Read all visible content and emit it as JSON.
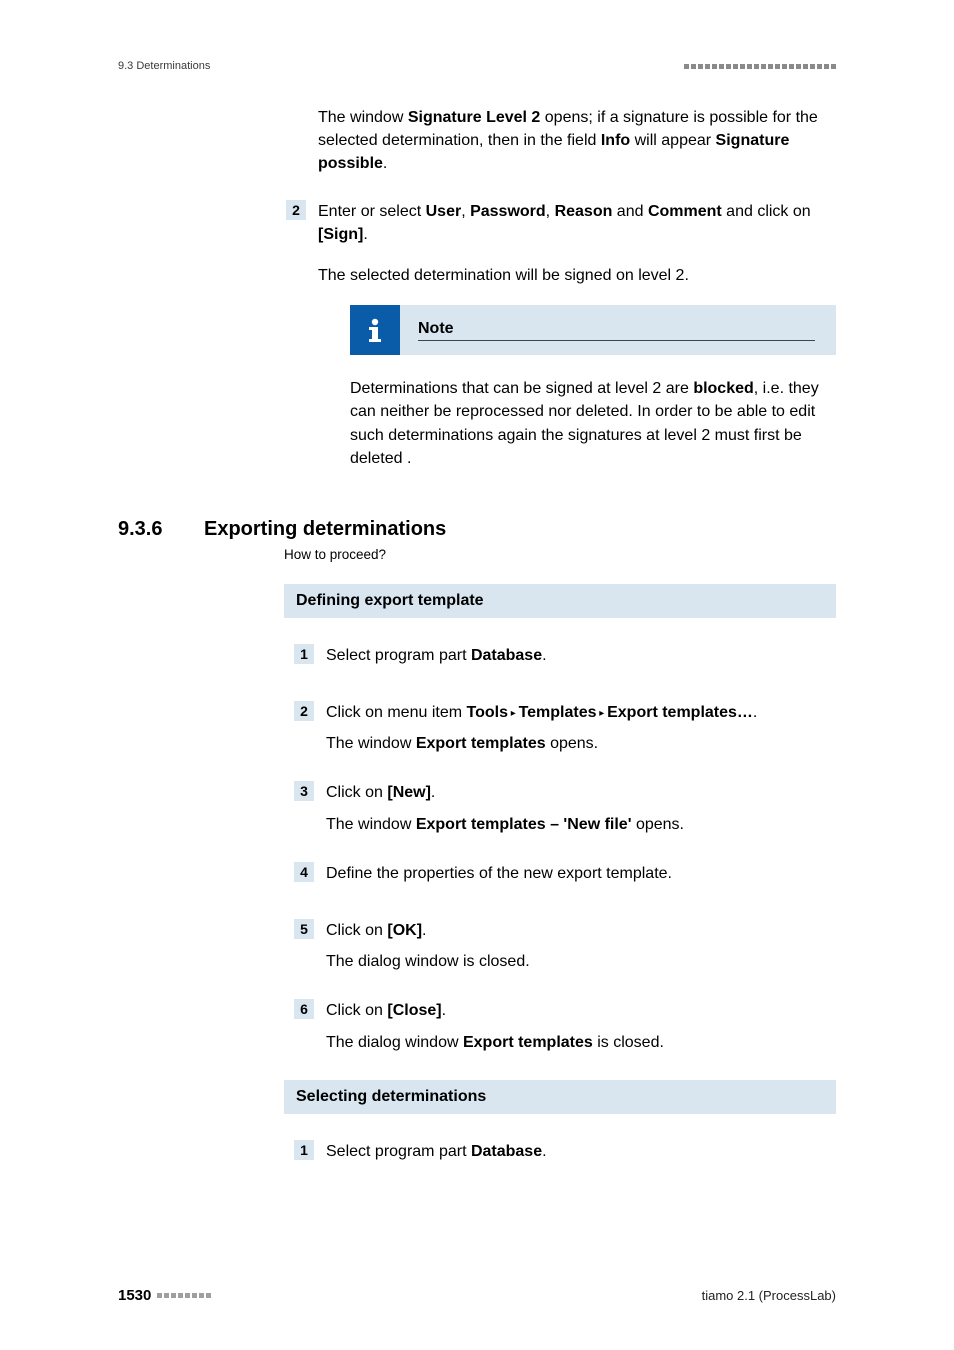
{
  "header": {
    "section_ref": "9.3 Determinations"
  },
  "top": {
    "p1_a": "The window ",
    "p1_b": "Signature Level 2",
    "p1_c": " opens; if a signature is possible for the selected determination, then in the field ",
    "p1_d": "Info",
    "p1_e": " will appear ",
    "p1_f": "Signa­ture possible",
    "p1_g": ".",
    "step2_num": "2",
    "step2_a": "Enter or select ",
    "step2_b": "User",
    "step2_c": ", ",
    "step2_d": "Password",
    "step2_e": ", ",
    "step2_f": "Reason",
    "step2_g": " and ",
    "step2_h": "Comment",
    "step2_i": " and click on ",
    "step2_j": "[Sign]",
    "step2_k": ".",
    "step2_result": "The selected determination will be signed on level 2.",
    "note_title": "Note",
    "note_a": "Determinations that can be signed at level 2 are ",
    "note_b": "blocked",
    "note_c": ", i.e. they can neither be reprocessed nor deleted. In order to be able to edit such determinations again the signatures at level 2 must first be deleted ."
  },
  "section": {
    "num": "9.3.6",
    "title": "Exporting determinations",
    "sub": "How to proceed?"
  },
  "block1": {
    "title": "Defining export template",
    "s1_num": "1",
    "s1_a": "Select program part ",
    "s1_b": "Database",
    "s1_c": ".",
    "s2_num": "2",
    "s2_a": "Click on menu item ",
    "s2_b": "Tools",
    "s2_sep1": " ▸ ",
    "s2_c": "Templates",
    "s2_sep2": " ▸ ",
    "s2_d": "Export templates…",
    "s2_e": ".",
    "s2_r_a": "The window ",
    "s2_r_b": "Export templates",
    "s2_r_c": " opens.",
    "s3_num": "3",
    "s3_a": "Click on ",
    "s3_b": "[New]",
    "s3_c": ".",
    "s3_r_a": "The window ",
    "s3_r_b": "Export templates – 'New file'",
    "s3_r_c": " opens.",
    "s4_num": "4",
    "s4_a": "Define the properties of the new export template.",
    "s5_num": "5",
    "s5_a": "Click on ",
    "s5_b": "[OK]",
    "s5_c": ".",
    "s5_r": "The dialog window is closed.",
    "s6_num": "6",
    "s6_a": "Click on ",
    "s6_b": "[Close]",
    "s6_c": ".",
    "s6_r_a": "The dialog window ",
    "s6_r_b": "Export templates",
    "s6_r_c": " is closed."
  },
  "block2": {
    "title": "Selecting determinations",
    "s1_num": "1",
    "s1_a": "Select program part ",
    "s1_b": "Database",
    "s1_c": "."
  },
  "footer": {
    "page": "1530",
    "product": "tiamo 2.1 (ProcessLab)"
  }
}
